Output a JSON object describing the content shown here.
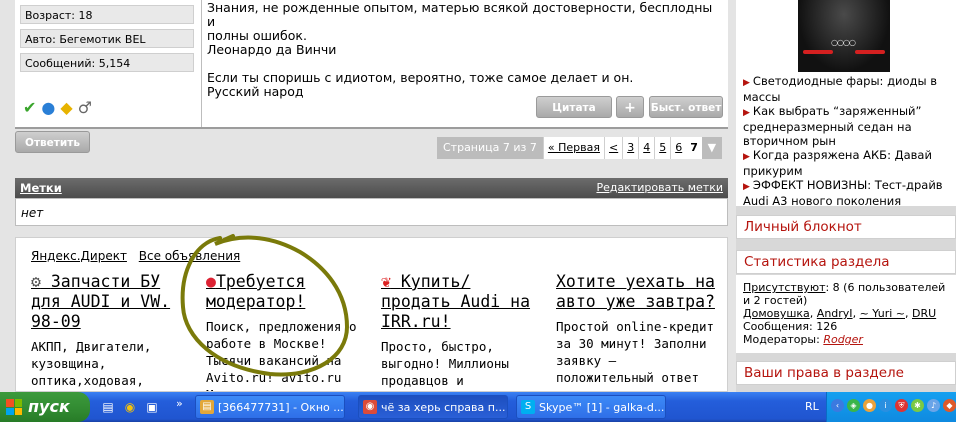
{
  "profile": {
    "age": "Возраст: 18",
    "car": "Авто: Бегемотик BEL",
    "messages": "Сообщений: 5,154",
    "icons": [
      "online-check-icon",
      "message-bubble-icon",
      "warning-icon",
      "male-gender-icon"
    ]
  },
  "post": {
    "lines": [
      "Знания, не рожденные опытом, матерью всякой достоверности, бесплодны и",
      "полны ошибок.",
      "Леонардо да Винчи",
      "",
      "Если ты споришь с идиотом, вероятно, тоже самое делает и он.",
      "Русский народ"
    ],
    "quote_label": "Цитата",
    "multiquote_label": "+",
    "quick_reply_label": "Быст. ответ"
  },
  "reply_label": "Ответить",
  "pager": {
    "label": "Страница 7 из 7",
    "first": "« Первая",
    "prev": "<",
    "pages": [
      "3",
      "4",
      "5",
      "6"
    ],
    "current": "7",
    "menu": "▼"
  },
  "tags": {
    "title": "Метки",
    "edit": "Редактировать метки",
    "value": "нет"
  },
  "ads": {
    "yandex": "Яндекс.Директ",
    "all": "Все объявления",
    "items": [
      {
        "icon": "car-part-icon",
        "title": "Запчасти БУ для AUDI и VW. 98-09",
        "desc": "АКПП, Двигатели, кузовщина, оптика,ходовая, электроника и др."
      },
      {
        "icon": "avito-icon",
        "title": "Требуется модератор!",
        "desc": "Поиск, предложения о работе в Москве! Тысячи вакансий на Avito.ru! avito.ru Москва"
      },
      {
        "icon": "irr-icon",
        "title": "Купить/ продать Audi на IRR.ru!",
        "desc": "Просто, быстро, выгодно! Миллионы продавцов и покупателей!"
      },
      {
        "icon": "",
        "title": "Хотите уехать на авто уже завтра?",
        "desc": "Простой online-кредит за 30 минут! Заполни заявку – положительный ответ"
      }
    ]
  },
  "sidebar": {
    "news": [
      "Светодиодные фары: диоды в массы",
      "Как выбрать “заряженный” среднеразмерный седан на вторичном рын",
      "Когда разряжена АКБ: Давай прикурим",
      "ЭФФЕКТ НОВИЗНЫ: Тест-драйв Audi A3 нового поколения"
    ],
    "notebook": "Личный блокнот",
    "stats_title": "Статистика раздела",
    "stats": {
      "present_label": "Присутствуют",
      "present_text": ": 8 (6 пользователей и 2 гостей)",
      "users": [
        "Домовушка",
        "AndryI",
        "~ Yuri ~",
        "DRU"
      ],
      "messages": "Сообщения: 126",
      "moderators_label": "Модераторы:",
      "moderator": "Rodger"
    },
    "rights_title": "Ваши права в разделе"
  },
  "taskbar": {
    "start": "пуск",
    "tasks": [
      {
        "label": "[366477731] - Окно ...",
        "icon": "qip-icon",
        "color": "#e2a73a"
      },
      {
        "label": "чё за херь справа п...",
        "icon": "chrome-icon",
        "color": "#dd4b39"
      },
      {
        "label": "Skype™ [1] - galka-d...",
        "icon": "skype-icon",
        "color": "#00aff0"
      }
    ],
    "lang": "RL"
  },
  "colors": {
    "accent_red": "#b5140e",
    "annotation_olive": "#7a7a0a"
  }
}
